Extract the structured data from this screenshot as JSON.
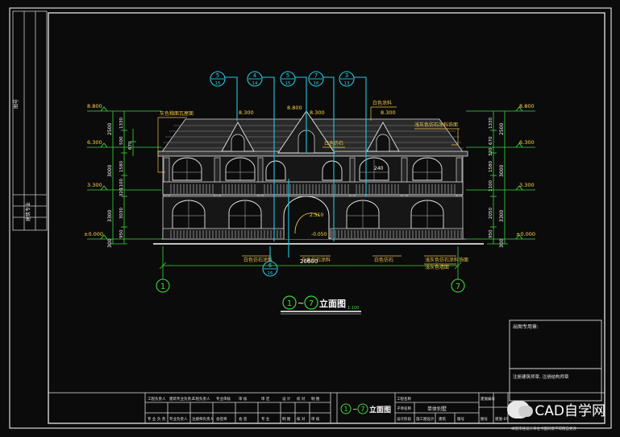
{
  "drawing": {
    "title_circle_left": "1",
    "title_circle_right": "7",
    "title_tilde": "~",
    "title_text": "立面图",
    "title_scale": "1:100",
    "total_width": "20600",
    "axis_left": "1",
    "axis_right": "7"
  },
  "left_side": {
    "vertical_label": "图号",
    "stamp_text": "建筑专业"
  },
  "callouts": [
    {
      "num": "5",
      "den": "15"
    },
    {
      "num": "4",
      "den": "14"
    },
    {
      "num": "5",
      "den": "15"
    },
    {
      "num": "7",
      "den": "16"
    },
    {
      "num": "3",
      "den": "13"
    }
  ],
  "bottom_callout": {
    "num": "6",
    "den": "16"
  },
  "levels_left": [
    "8.800",
    "6.300",
    "3.300",
    "±0.000"
  ],
  "levels_right": [
    "8.800",
    "6.300",
    "3.300",
    "±0.000"
  ],
  "ridge_levels": [
    "8.300",
    "8.800",
    "8.300",
    "8.300"
  ],
  "dims_left_outer": [
    "2500",
    "3000",
    "3300",
    "300"
  ],
  "dims_left_inner": [
    "1330",
    "500",
    "670",
    "1580",
    "320",
    "1100",
    "3030",
    "950"
  ],
  "dims_right_inner": [
    "1330",
    "670",
    "320",
    "1580",
    "1100",
    "2050",
    "950"
  ],
  "dims_right_outer": [
    "2500",
    "3000",
    "3300",
    "300"
  ],
  "mid_labels": [
    "240",
    "2.510",
    "-0.050"
  ],
  "notes": {
    "top_left": "灰色釉面瓦屋面",
    "top_right": "白色涂料",
    "top_right2": "浅灰色仿石涂料饰面",
    "dormer": "白色仿石",
    "bottom_left": "白色仿石涂料",
    "bottom_mid": "白色仿石涂料",
    "bottom_right": "白色仿石",
    "bottom_right2": "浅灰色仿石涂料饰面",
    "bottom_right3": "浅灰色墙面"
  },
  "title_block": {
    "approval_label": "出图专用章:",
    "note_text": "注册建筑师章, 注册结构师章",
    "row1": [
      "工程负责人",
      "建筑专业负责人",
      "工程负责人",
      "专业审核",
      "审 核",
      "审 定",
      "设 计",
      "校 对",
      "制 图"
    ],
    "row2": [
      "专 业 负 责",
      "专业负责人",
      "注册师负责人",
      "会签师",
      "会 签",
      "专 业",
      "制 图",
      "核 对",
      "审 核"
    ],
    "center_title": "立面图",
    "project_label": "工程名称",
    "project_name": "单体别墅",
    "item_label": "子项名称",
    "item_a": "设计阶段",
    "item_b": "施工图设计",
    "item_c": "专业",
    "item_d": "建筑",
    "item_e": "版号",
    "sheet_label": "图号",
    "sheet_value": "建施-05",
    "right_code": "建施编号",
    "footer": "本图未经设计单位书面同意不得擅自更改"
  },
  "watermark": "CAD自学网"
}
